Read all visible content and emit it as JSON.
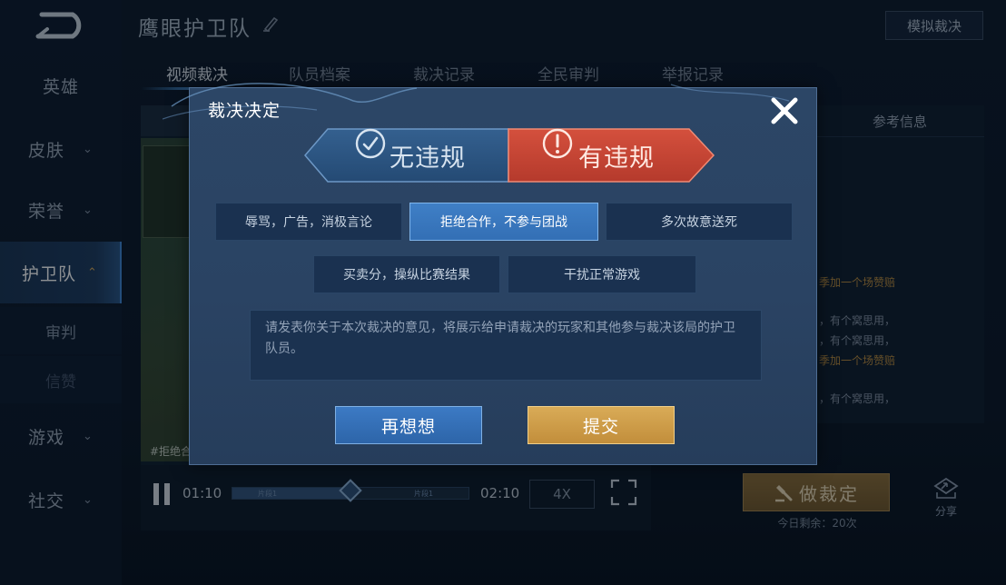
{
  "sidebar": {
    "items": [
      {
        "label": "英雄",
        "chevron": ""
      },
      {
        "label": "皮肤",
        "chevron": "⌄"
      },
      {
        "label": "荣誉",
        "chevron": "⌄"
      },
      {
        "label": "护卫队",
        "chevron": "⌃"
      },
      {
        "label": "审判",
        "chevron": ""
      },
      {
        "label": "信赞",
        "chevron": ""
      },
      {
        "label": "游戏",
        "chevron": "⌄"
      },
      {
        "label": "社交",
        "chevron": "⌄"
      }
    ]
  },
  "header": {
    "title": "鹰眼护卫队",
    "mock_button": "模拟裁决"
  },
  "tabs": [
    "视频裁决",
    "队员档案",
    "裁决记录",
    "全民审判",
    "举报记录"
  ],
  "video": {
    "caption": "#拒绝合",
    "current_time": "01:10",
    "end_time": "02:10",
    "speed": "4X",
    "progress_fraction": 0.5,
    "progress_segment_1": "片段1",
    "progress_segment_2": "片段1"
  },
  "info_panel": {
    "header": "参考信息",
    "line_1": "季加一个场赞赔",
    "line_2": "，有个窝思用，",
    "line_3": "，有个窝思用，",
    "line_4": "季加一个场赞赔",
    "line_5": "，有个窝思用，"
  },
  "verdict": {
    "button": "做裁定",
    "remaining": "今日剩余：20次"
  },
  "share": {
    "label": "分享"
  },
  "modal": {
    "title": "裁决决定",
    "choice_no": "无违规",
    "choice_yes": "有违规",
    "reasons": [
      "辱骂，广告，消极言论",
      "拒绝合作，不参与团战",
      "多次故意送死",
      "买卖分，操纵比赛结果",
      "干扰正常游戏"
    ],
    "comment_placeholder": "请发表你关于本次裁决的意见，将展示给申请裁决的玩家和其他参与裁决该局的护卫队员。",
    "cancel_button": "再想想",
    "submit_button": "提交"
  },
  "colors": {
    "accent_blue": "#3f7fc6",
    "violation_red": "#c94434",
    "submit_gold": "#d9ab57"
  }
}
